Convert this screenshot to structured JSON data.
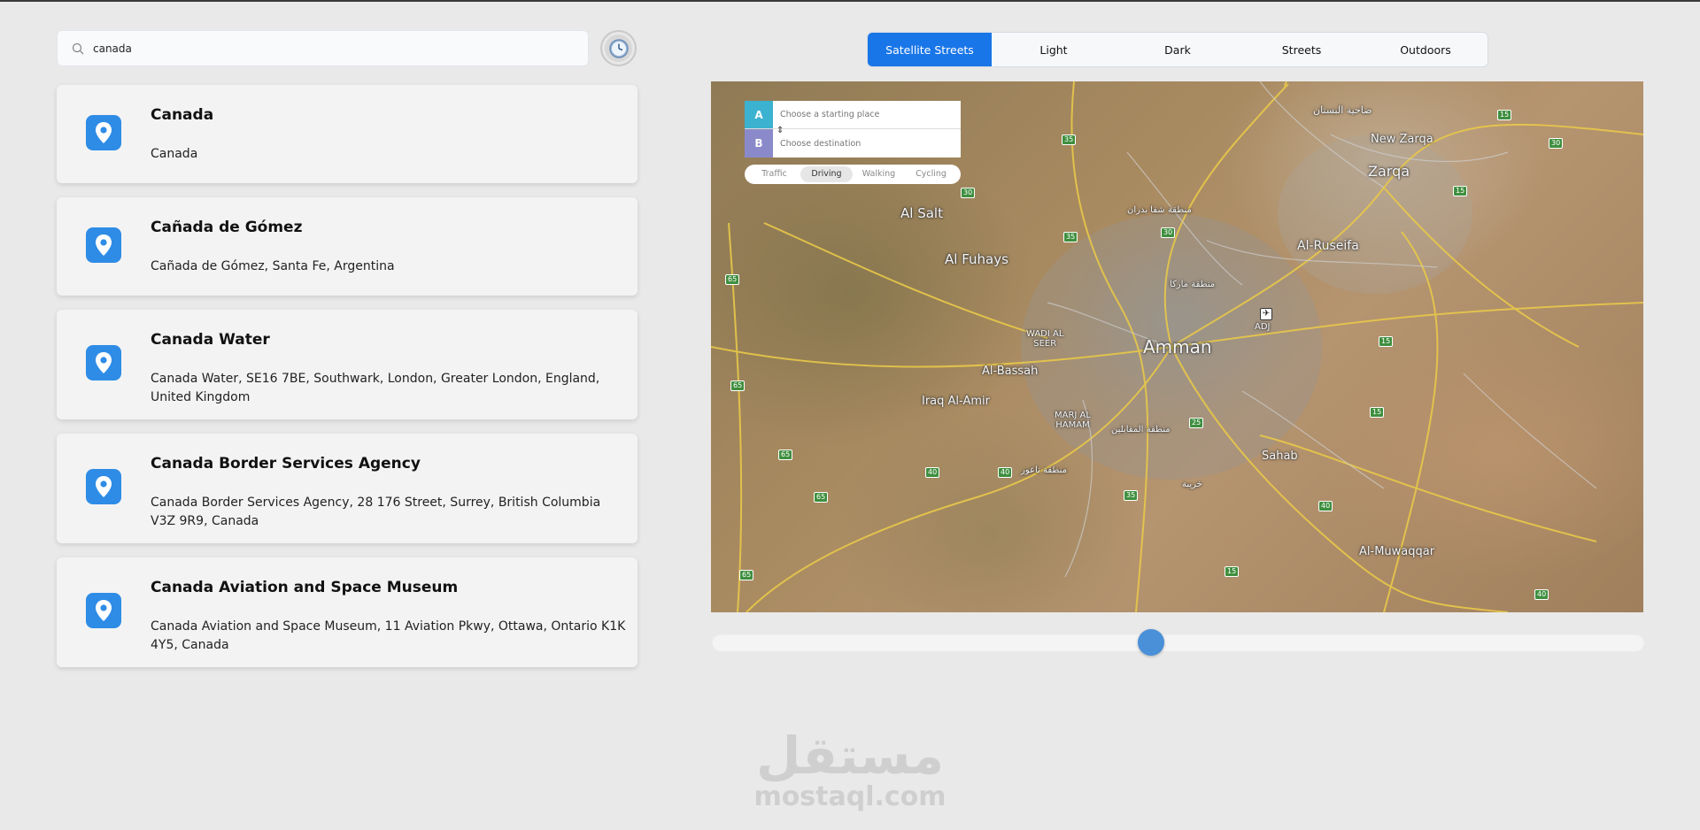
{
  "search": {
    "value": "canada",
    "icon": "search-icon"
  },
  "history_button": {
    "icon": "clock-icon"
  },
  "results": [
    {
      "name": "Canada",
      "address": "Canada"
    },
    {
      "name": "Cañada de Gómez",
      "address": "Cañada de Gómez, Santa Fe, Argentina"
    },
    {
      "name": "Canada Water",
      "address": "Canada Water, SE16 7BE, Southwark, London, Greater London, England, United Kingdom"
    },
    {
      "name": "Canada Border Services Agency",
      "address": "Canada Border Services Agency, 28 176 Street, Surrey, British Columbia V3Z 9R9, Canada"
    },
    {
      "name": "Canada Aviation and Space Museum",
      "address": "Canada Aviation and Space Museum, 11 Aviation Pkwy, Ottawa, Ontario K1K 4Y5, Canada"
    }
  ],
  "map_styles": {
    "tabs": [
      "Satellite Streets",
      "Light",
      "Dark",
      "Streets",
      "Outdoors"
    ],
    "active": "Satellite Streets"
  },
  "directions": {
    "a_label": "A",
    "b_label": "B",
    "origin_placeholder": "Choose a starting place",
    "destination_placeholder": "Choose destination",
    "profiles": [
      "Traffic",
      "Driving",
      "Walking",
      "Cycling"
    ],
    "active_profile": "Driving"
  },
  "map": {
    "places": {
      "amman": "Amman",
      "zarqa": "Zarqa",
      "new_zarqa": "New Zarqa",
      "al_salt": "Al Salt",
      "al_fuhays": "Al Fuhays",
      "al_ruseifa": "Al-Ruseifa",
      "wadi_al_seer": "WADI AL\nSEER",
      "al_bassah": "Al-Bassah",
      "iraq_al_amir": "Iraq Al-Amir",
      "marj_al_hamam": "MARJ AL\nHAMAM",
      "sahab": "Sahab",
      "al_muwaqqar": "Al-Muwaqqar",
      "adj": "ADJ",
      "ar_1": "ضاحية البستان",
      "ar_2": "منطقة شفا بدران",
      "ar_3": "منطقة ماركا",
      "ar_4": "منطقة المقابلين",
      "ar_5": "منطقة ناعور",
      "ar_6": "خريبة"
    },
    "shields": [
      "15",
      "30",
      "35",
      "30",
      "30",
      "35",
      "15",
      "65",
      "65",
      "15",
      "15",
      "65",
      "40",
      "40",
      "65",
      "35",
      "25",
      "40",
      "15",
      "65",
      "40",
      "35"
    ]
  },
  "slider": {
    "value": 0.47
  },
  "watermark": {
    "arabic": "مستقل",
    "latin": "mostaql.com"
  }
}
